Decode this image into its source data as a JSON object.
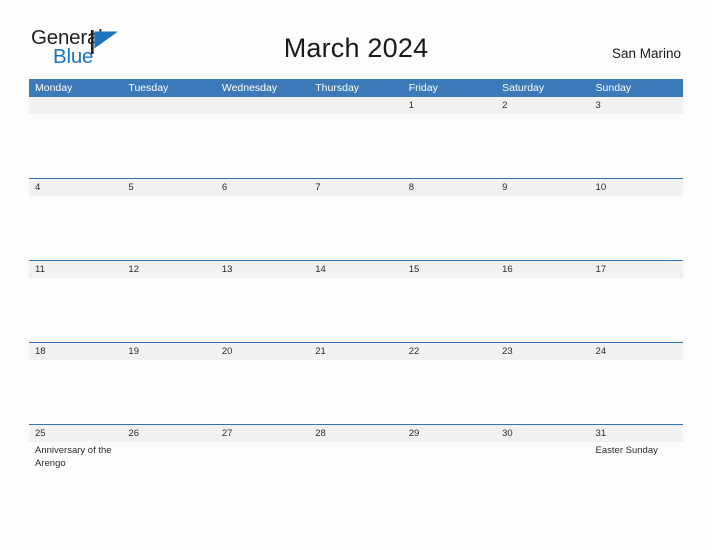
{
  "brand": {
    "name_part1": "General",
    "name_part2": "Blue",
    "flag_color": "#1e74bb",
    "pole_color": "#231f20"
  },
  "header": {
    "title": "March 2024",
    "region": "San Marino"
  },
  "calendar": {
    "accent_color": "#3b79b8",
    "row_line_color": "#2f74b5",
    "daynum_band_color": "#f1f1f1",
    "weekdays": [
      "Monday",
      "Tuesday",
      "Wednesday",
      "Thursday",
      "Friday",
      "Saturday",
      "Sunday"
    ],
    "weeks": [
      {
        "days": [
          {
            "num": "",
            "events": []
          },
          {
            "num": "",
            "events": []
          },
          {
            "num": "",
            "events": []
          },
          {
            "num": "",
            "events": []
          },
          {
            "num": "1",
            "events": []
          },
          {
            "num": "2",
            "events": []
          },
          {
            "num": "3",
            "events": []
          }
        ]
      },
      {
        "days": [
          {
            "num": "4",
            "events": []
          },
          {
            "num": "5",
            "events": []
          },
          {
            "num": "6",
            "events": []
          },
          {
            "num": "7",
            "events": []
          },
          {
            "num": "8",
            "events": []
          },
          {
            "num": "9",
            "events": []
          },
          {
            "num": "10",
            "events": []
          }
        ]
      },
      {
        "days": [
          {
            "num": "11",
            "events": []
          },
          {
            "num": "12",
            "events": []
          },
          {
            "num": "13",
            "events": []
          },
          {
            "num": "14",
            "events": []
          },
          {
            "num": "15",
            "events": []
          },
          {
            "num": "16",
            "events": []
          },
          {
            "num": "17",
            "events": []
          }
        ]
      },
      {
        "days": [
          {
            "num": "18",
            "events": []
          },
          {
            "num": "19",
            "events": []
          },
          {
            "num": "20",
            "events": []
          },
          {
            "num": "21",
            "events": []
          },
          {
            "num": "22",
            "events": []
          },
          {
            "num": "23",
            "events": []
          },
          {
            "num": "24",
            "events": []
          }
        ]
      },
      {
        "days": [
          {
            "num": "25",
            "events": [
              "Anniversary of the Arengo"
            ]
          },
          {
            "num": "26",
            "events": []
          },
          {
            "num": "27",
            "events": []
          },
          {
            "num": "28",
            "events": []
          },
          {
            "num": "29",
            "events": []
          },
          {
            "num": "30",
            "events": []
          },
          {
            "num": "31",
            "events": [
              "Easter Sunday"
            ]
          }
        ]
      }
    ]
  }
}
